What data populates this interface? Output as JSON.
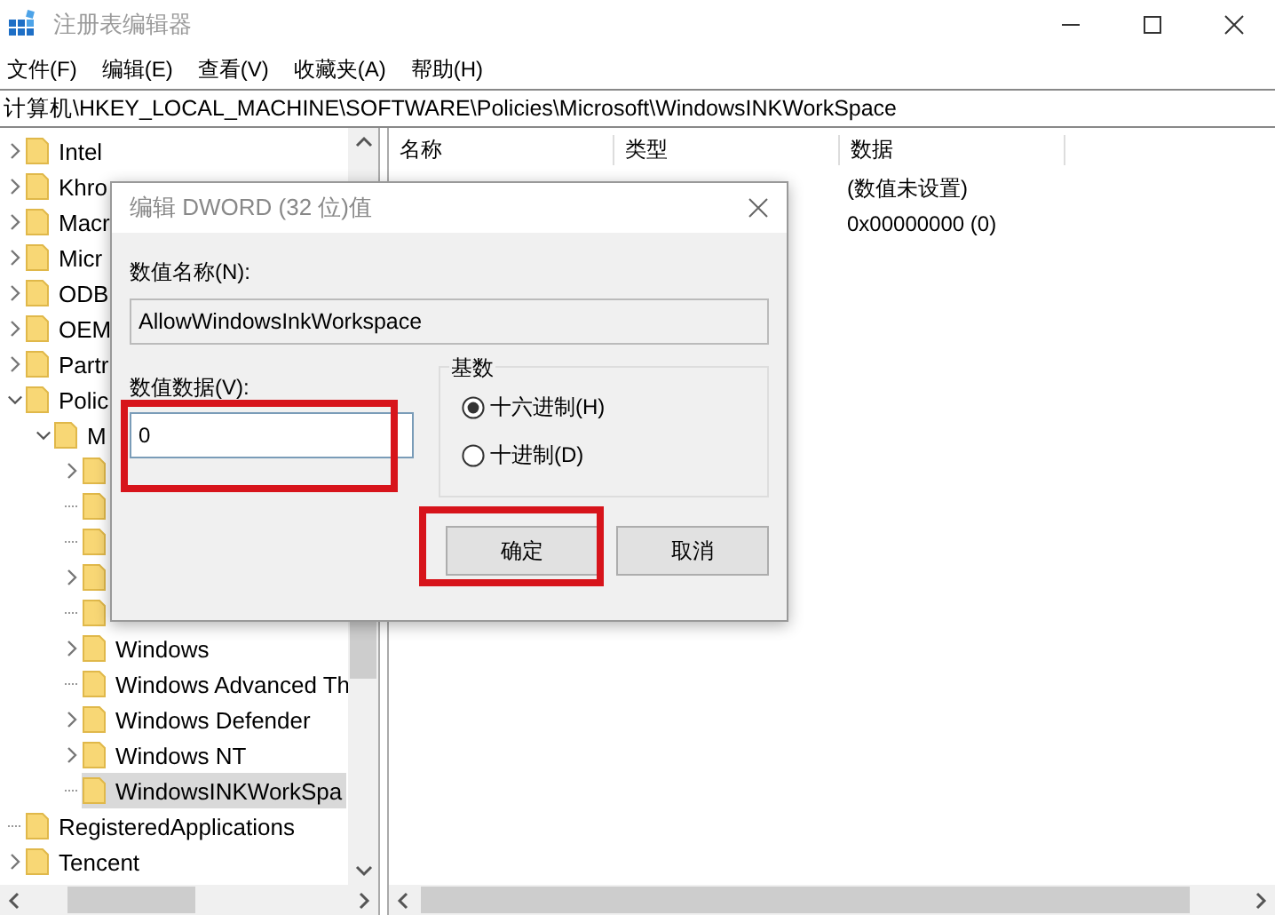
{
  "window": {
    "title": "注册表编辑器"
  },
  "menu": [
    "文件(F)",
    "编辑(E)",
    "查看(V)",
    "收藏夹(A)",
    "帮助(H)"
  ],
  "address": "计算机\\HKEY_LOCAL_MACHINE\\SOFTWARE\\Policies\\Microsoft\\WindowsINKWorkSpace",
  "tree": [
    {
      "label": "Intel",
      "expandable": true,
      "expanded": false,
      "selected": false
    },
    {
      "label": "Khro",
      "expandable": true,
      "expanded": false,
      "selected": false
    },
    {
      "label": "Macr",
      "expandable": true,
      "expanded": false,
      "selected": false
    },
    {
      "label": "Micr",
      "expandable": true,
      "expanded": false,
      "selected": false
    },
    {
      "label": "ODB",
      "expandable": true,
      "expanded": false,
      "selected": false
    },
    {
      "label": "OEM",
      "expandable": true,
      "expanded": false,
      "selected": false
    },
    {
      "label": "Partr",
      "expandable": true,
      "expanded": false,
      "selected": false
    },
    {
      "label": "Polic",
      "expandable": true,
      "expanded": true,
      "selected": false,
      "children": [
        {
          "label": "M",
          "expandable": true,
          "expanded": true,
          "selected": false,
          "children": [
            {
              "expandable": true,
              "expanded": false,
              "selected": false
            },
            {
              "expandable": false,
              "selected": false
            },
            {
              "expandable": false,
              "selected": false
            },
            {
              "expandable": true,
              "expanded": false,
              "selected": false
            },
            {
              "expandable": false,
              "selected": false
            },
            {
              "label": "Windows",
              "expandable": true,
              "expanded": false,
              "selected": false
            },
            {
              "label": "Windows Advanced Th",
              "expandable": false,
              "selected": false
            },
            {
              "label": "Windows Defender",
              "expandable": true,
              "expanded": false,
              "selected": false
            },
            {
              "label": "Windows NT",
              "expandable": true,
              "expanded": false,
              "selected": false
            },
            {
              "label": "WindowsINKWorkSpa",
              "expandable": false,
              "selected": true
            }
          ]
        }
      ]
    },
    {
      "label": "RegisteredApplications",
      "expandable": false,
      "selected": false
    },
    {
      "label": "Tencent",
      "expandable": true,
      "expanded": false,
      "selected": false
    }
  ],
  "values": {
    "columns": [
      "名称",
      "类型",
      "数据"
    ],
    "rows": [
      {
        "data": "(数值未设置)"
      },
      {
        "data": "0x00000000 (0)"
      }
    ]
  },
  "dialog": {
    "title": "编辑 DWORD (32 位)值",
    "name_label": "数值名称(N):",
    "name_value": "AllowWindowsInkWorkspace",
    "data_label": "数值数据(V):",
    "data_value": "0",
    "data_highlighted": true,
    "base_label": "基数",
    "radios": [
      {
        "label": "十六进制(H)",
        "selected": true
      },
      {
        "label": "十进制(D)",
        "selected": false
      }
    ],
    "buttons": [
      {
        "label": "确定",
        "highlighted": true
      },
      {
        "label": "取消",
        "highlighted": false
      }
    ]
  }
}
